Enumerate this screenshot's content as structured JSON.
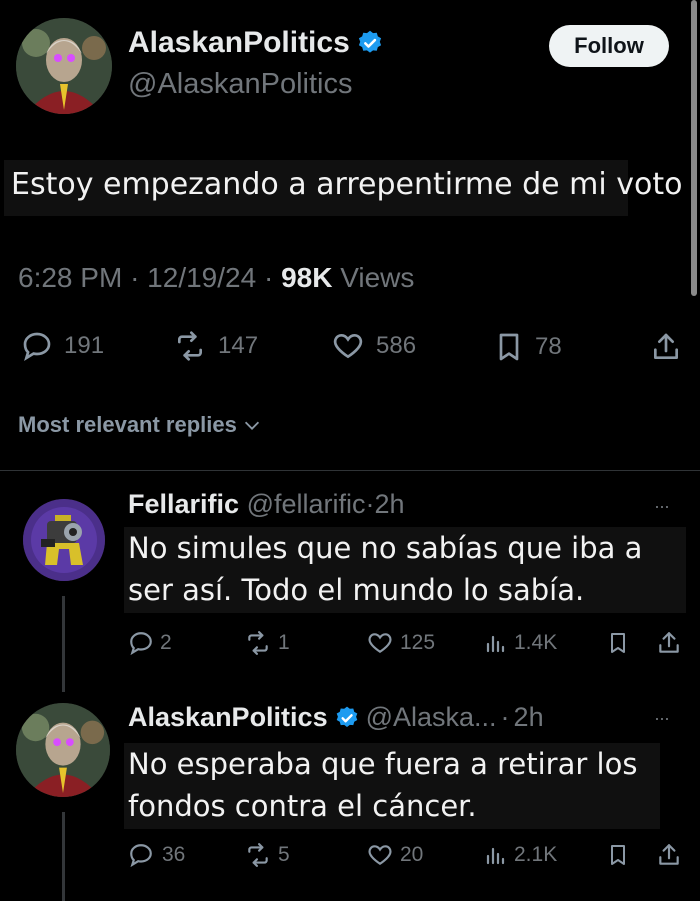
{
  "main_tweet": {
    "display_name": "AlaskanPolitics",
    "handle": "@AlaskanPolitics",
    "follow_label": "Follow",
    "text": "Estoy empezando a arrepentirme de mi voto",
    "time": "6:28 PM",
    "date": "12/19/24",
    "views_count": "98K",
    "views_label": "Views",
    "replies": "191",
    "reposts": "147",
    "likes": "586",
    "bookmarks": "78"
  },
  "sort": {
    "label": "Most relevant replies"
  },
  "replies": [
    {
      "display_name": "Fellarific",
      "handle": "@fellarific",
      "separator": "·",
      "time": "2h",
      "more": "···",
      "text_line1": "No simules que no sabías que iba a",
      "text_line2": "ser así. Todo el mundo lo sabía.",
      "replies": "2",
      "reposts": "1",
      "likes": "125",
      "views": "1.4K"
    },
    {
      "display_name": "AlaskanPolitics",
      "handle": "@Alaska...",
      "separator": "·",
      "time": "2h",
      "more": "···",
      "text_line1": "No esperaba que fuera a retirar los",
      "text_line2": "fondos contra el cáncer.",
      "replies": "36",
      "reposts": "5",
      "likes": "20",
      "views": "2.1K"
    }
  ],
  "colors": {
    "background": "#000000",
    "text": "#e7e9ea",
    "muted": "#71767b",
    "verified": "#1d9bf0"
  }
}
